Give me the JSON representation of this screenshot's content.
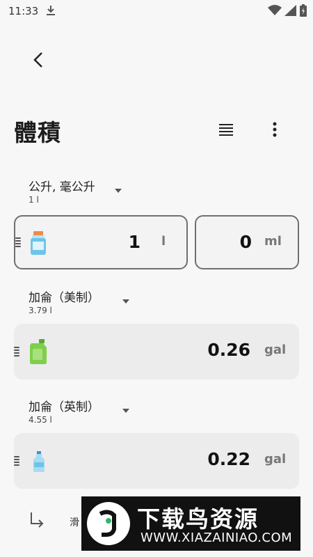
{
  "status_bar": {
    "time": "11:33"
  },
  "header": {
    "title": "體積"
  },
  "units": [
    {
      "name": "公升, 毫公升",
      "sub": "1 l",
      "value_main": "1",
      "unit_main": "l",
      "value_secondary": "0",
      "unit_secondary": "ml"
    },
    {
      "name": "加侖（美制）",
      "sub": "3.79 l",
      "value": "0.26",
      "unit": "gal"
    },
    {
      "name": "加侖（英制）",
      "sub": "4.55 l",
      "value": "0.22",
      "unit": "gal"
    }
  ],
  "footer": {
    "partial_text": "滑"
  },
  "watermark": {
    "title": "下载鸟资源",
    "url": "WWW.XIAZAINIAO.COM"
  },
  "colors": {
    "background": "#f7f7f7",
    "card_filled": "#ececec",
    "card_border": "#6f6f6f",
    "green_bottle": "#7fcf4a",
    "blue_bottle": "#6cc5e8"
  },
  "icons": [
    "download-icon",
    "wifi-icon",
    "signal-icon",
    "battery-icon",
    "back-arrow-icon",
    "list-icon",
    "more-vertical-icon",
    "medicine-bottle-icon",
    "jerry-can-icon",
    "water-bottle-icon",
    "subdirectory-arrow-icon"
  ]
}
